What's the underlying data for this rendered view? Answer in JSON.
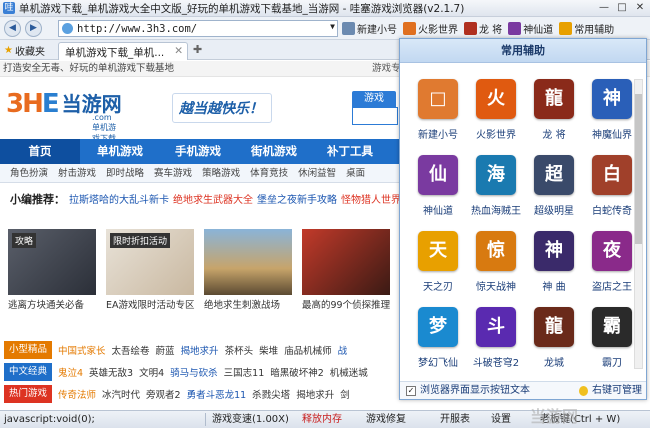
{
  "window": {
    "title": "单机游戏下载_单机游戏大全中文版_好玩的单机游戏下载基地_当游网 - 哇塞游戏浏览器(v2.1.7)"
  },
  "address": {
    "url": "http://www.3h3.com/"
  },
  "quicklinks": [
    {
      "label": "新建小号",
      "color": "#6b8ab0"
    },
    {
      "label": "火影世界",
      "color": "#e07020"
    },
    {
      "label": "龙 将",
      "color": "#b03020"
    },
    {
      "label": "神仙道",
      "color": "#7a3aa0"
    },
    {
      "label": "常用辅助",
      "color": "#e8a000"
    }
  ],
  "tabs": {
    "favorites": "收藏夹",
    "active": "单机游戏下载_单机..."
  },
  "page": {
    "strip_left": "打造安全无毒、好玩的单机游戏下载基地",
    "strip_right": "游戏专",
    "logo": {
      "a": "3H",
      "b": "E",
      "name": "当游网",
      "domain": ".com 单机游戏下载"
    },
    "slogan": "越当越快乐！",
    "search_tab": "游戏",
    "nav": [
      "首页",
      "单机游戏",
      "手机游戏",
      "街机游戏",
      "补丁工具"
    ],
    "subnav": [
      "角色扮演",
      "射击游戏",
      "即时战略",
      "赛车游戏",
      "策略游戏",
      "体育竞技",
      "休闲益智",
      "桌面"
    ],
    "rec": {
      "label": "小编推荐：",
      "items": [
        "拉斯塔哈的大乱斗新卡",
        "绝地求生武器大全",
        "堡垒之夜新手攻略",
        "怪物猎人世界MOD大"
      ]
    },
    "thumbs": [
      {
        "badge": "攻略",
        "cap": "逃离方块通关必备"
      },
      {
        "badge": "限时折扣活动",
        "cap": "EA游戏限时活动专区"
      },
      {
        "badge": "",
        "cap": "绝地求生刺激战场"
      },
      {
        "badge": "",
        "cap": "最高的99个侦探推理"
      }
    ],
    "rows": [
      {
        "tag": "小型精品",
        "color": "#e47a00",
        "items": [
          "中国式家长",
          "太吾绘卷",
          "蔚蓝",
          "揭地求升",
          "茶杯头",
          "柴堆",
          "庙品机械师",
          "战"
        ]
      },
      {
        "tag": "中文经典",
        "color": "#1f6fc9",
        "items": [
          "鬼泣4",
          "英雄无敌3",
          "文明4",
          "骑马与砍杀",
          "三国志11",
          "暗黑破坏神2",
          "机械迷城"
        ]
      },
      {
        "tag": "热门游戏",
        "color": "#d32",
        "items": [
          "传奇法师",
          "冰汽时代",
          "旁观者2",
          "勇者斗恶龙11",
          "杀戮尖塔",
          "揭地求升",
          "剑"
        ]
      }
    ]
  },
  "panel": {
    "title": "常用辅助",
    "apps": [
      {
        "label": "新建小号",
        "glyph": "□",
        "color": "#e07a30"
      },
      {
        "label": "火影世界",
        "glyph": "火",
        "color": "#e05a10"
      },
      {
        "label": "龙 将",
        "glyph": "龍",
        "color": "#8a2a1a"
      },
      {
        "label": "神魔仙界",
        "glyph": "神",
        "color": "#2a5fb8"
      },
      {
        "label": "神仙道",
        "glyph": "仙",
        "color": "#7a3aa0"
      },
      {
        "label": "热血海贼王",
        "glyph": "海",
        "color": "#1a7ab0"
      },
      {
        "label": "超级明星",
        "glyph": "超",
        "color": "#3a4a6a"
      },
      {
        "label": "白蛇传奇",
        "glyph": "白",
        "color": "#a0402a"
      },
      {
        "label": "天之刃",
        "glyph": "天",
        "color": "#e8a000"
      },
      {
        "label": "惊天战神",
        "glyph": "惊",
        "color": "#d87a10"
      },
      {
        "label": "神 曲",
        "glyph": "神",
        "color": "#3a2a6a"
      },
      {
        "label": "盗店之王",
        "glyph": "夜",
        "color": "#8a2a8a"
      },
      {
        "label": "梦幻飞仙",
        "glyph": "梦",
        "color": "#1a8ad0"
      },
      {
        "label": "斗破苍穹2",
        "glyph": "斗",
        "color": "#5a2ab0"
      },
      {
        "label": "龙城",
        "glyph": "龍",
        "color": "#6a2a1a"
      },
      {
        "label": "霸刀",
        "glyph": "霸",
        "color": "#2a2a2a"
      }
    ],
    "footer": {
      "check": "浏览器界面显示按钮文本",
      "manage": "右键可管理"
    }
  },
  "status": {
    "js": "javascript:void(0);",
    "speed": "游戏变速(1.00X)",
    "mem": "释放内存",
    "repair": "游戏修复",
    "boss": "开服表",
    "settings": "设置",
    "bosskey": "老板键(Ctrl + W)",
    "watermark": "当游网"
  }
}
